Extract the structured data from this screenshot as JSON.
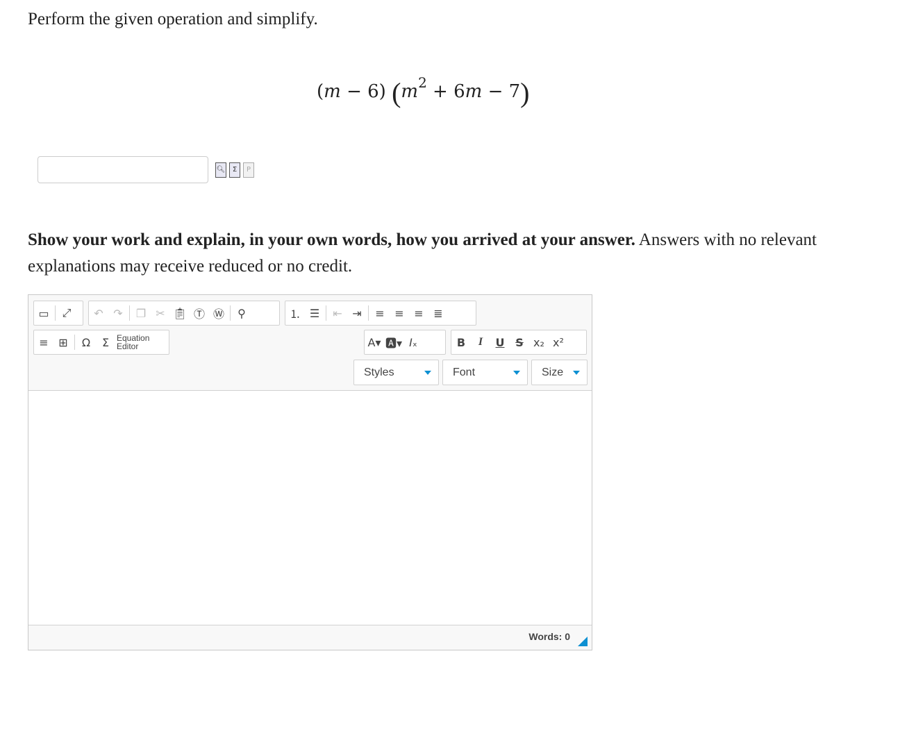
{
  "prompt": "Perform the given operation and simplify.",
  "expression": {
    "open_paren": "(",
    "var1": "m",
    "minus1": " − 6)",
    "big_open": "(",
    "var2": "m",
    "exp": "2",
    "plus": " + 6",
    "var3": "m",
    "minus2": " − 7",
    "big_close": ")"
  },
  "answer": {
    "value": "",
    "placeholder": ""
  },
  "answer_tools": [
    "preview-icon",
    "equation-icon",
    "clear-icon"
  ],
  "instructions": {
    "bold": "Show your work and explain, in your own words, how you arrived at your answer.",
    "rest": " Answers with no relevant explanations may receive reduced or no credit."
  },
  "editor": {
    "equation_label_1": "Equation",
    "equation_label_2": "Editor",
    "styles_label": "Styles",
    "font_label": "Font",
    "size_label": "Size",
    "words_label": "Words: 0",
    "accent_color": "#0e90d2"
  }
}
